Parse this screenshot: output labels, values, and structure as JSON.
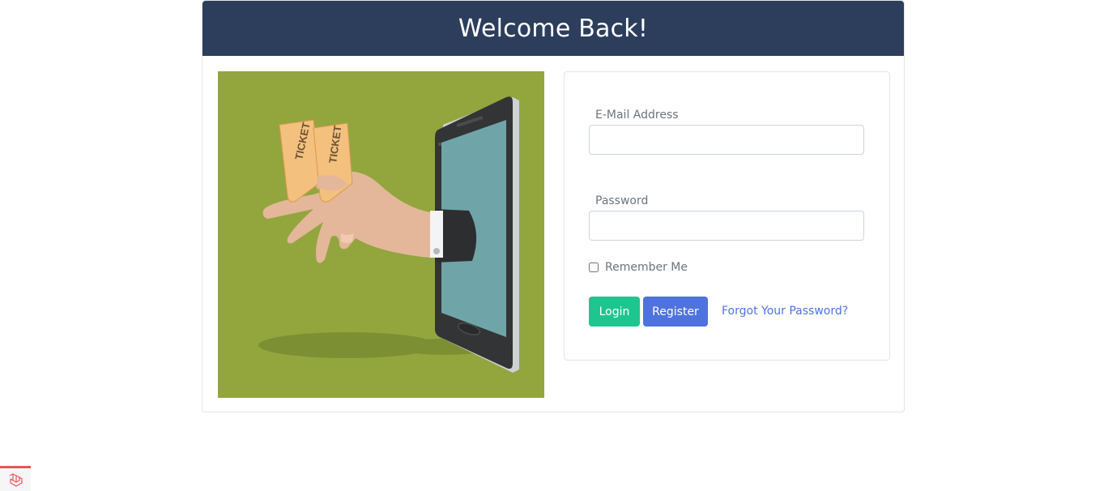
{
  "header": {
    "title": "Welcome Back!"
  },
  "illustration": {
    "alt": "Hand holding tickets reaching out of a phone",
    "ticket_text": "TICKET",
    "colors": {
      "background": "#92a63d",
      "screen": "#6fa5a8",
      "ticket": "#f3c07e",
      "skin": "#e4b79a"
    }
  },
  "form": {
    "email_label": "E-Mail Address",
    "email_value": "",
    "password_label": "Password",
    "password_value": "",
    "remember_label": "Remember Me",
    "remember_checked": false,
    "login_label": "Login",
    "register_label": "Register",
    "forgot_label": "Forgot Your Password?"
  },
  "colors": {
    "header_bg": "#2c3e5c",
    "login_btn": "#1fc58f",
    "register_btn": "#4e73df",
    "link": "#4e73df"
  },
  "corner_icon": "laravel-logo-icon"
}
